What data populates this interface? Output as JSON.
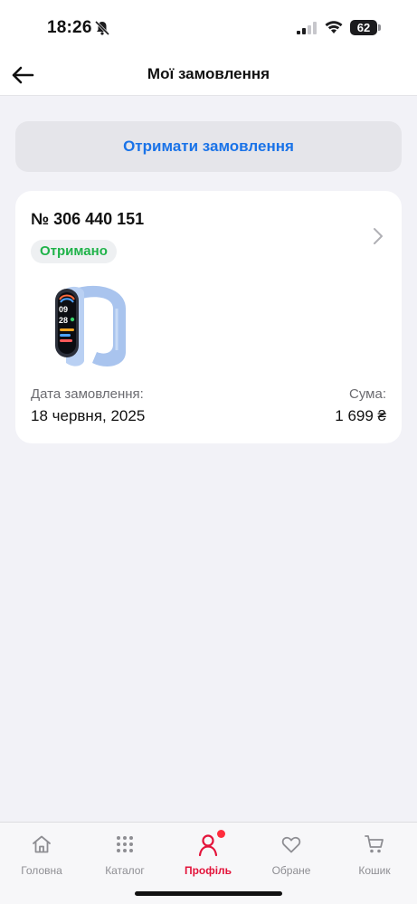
{
  "status_bar": {
    "time": "18:26",
    "battery": "62"
  },
  "header": {
    "title": "Мої замовлення"
  },
  "receive_button": {
    "label": "Отримати замовлення"
  },
  "order": {
    "number": "№ 306 440 151",
    "status": "Отримано",
    "status_color": "#20b34a",
    "product_image": "fitness-band-light-blue",
    "date_label": "Дата замовлення:",
    "date": "18 червня, 2025",
    "sum_label": "Сума:",
    "sum": "1 699 ₴"
  },
  "tab_bar": {
    "active_color": "#e3133a",
    "items": [
      {
        "label": "Головна",
        "icon": "home-icon"
      },
      {
        "label": "Каталог",
        "icon": "grid-icon"
      },
      {
        "label": "Профіль",
        "icon": "profile-icon",
        "active": true
      },
      {
        "label": "Обране",
        "icon": "heart-icon"
      },
      {
        "label": "Кошик",
        "icon": "cart-icon"
      }
    ]
  },
  "accent_color": "#1a73e8"
}
